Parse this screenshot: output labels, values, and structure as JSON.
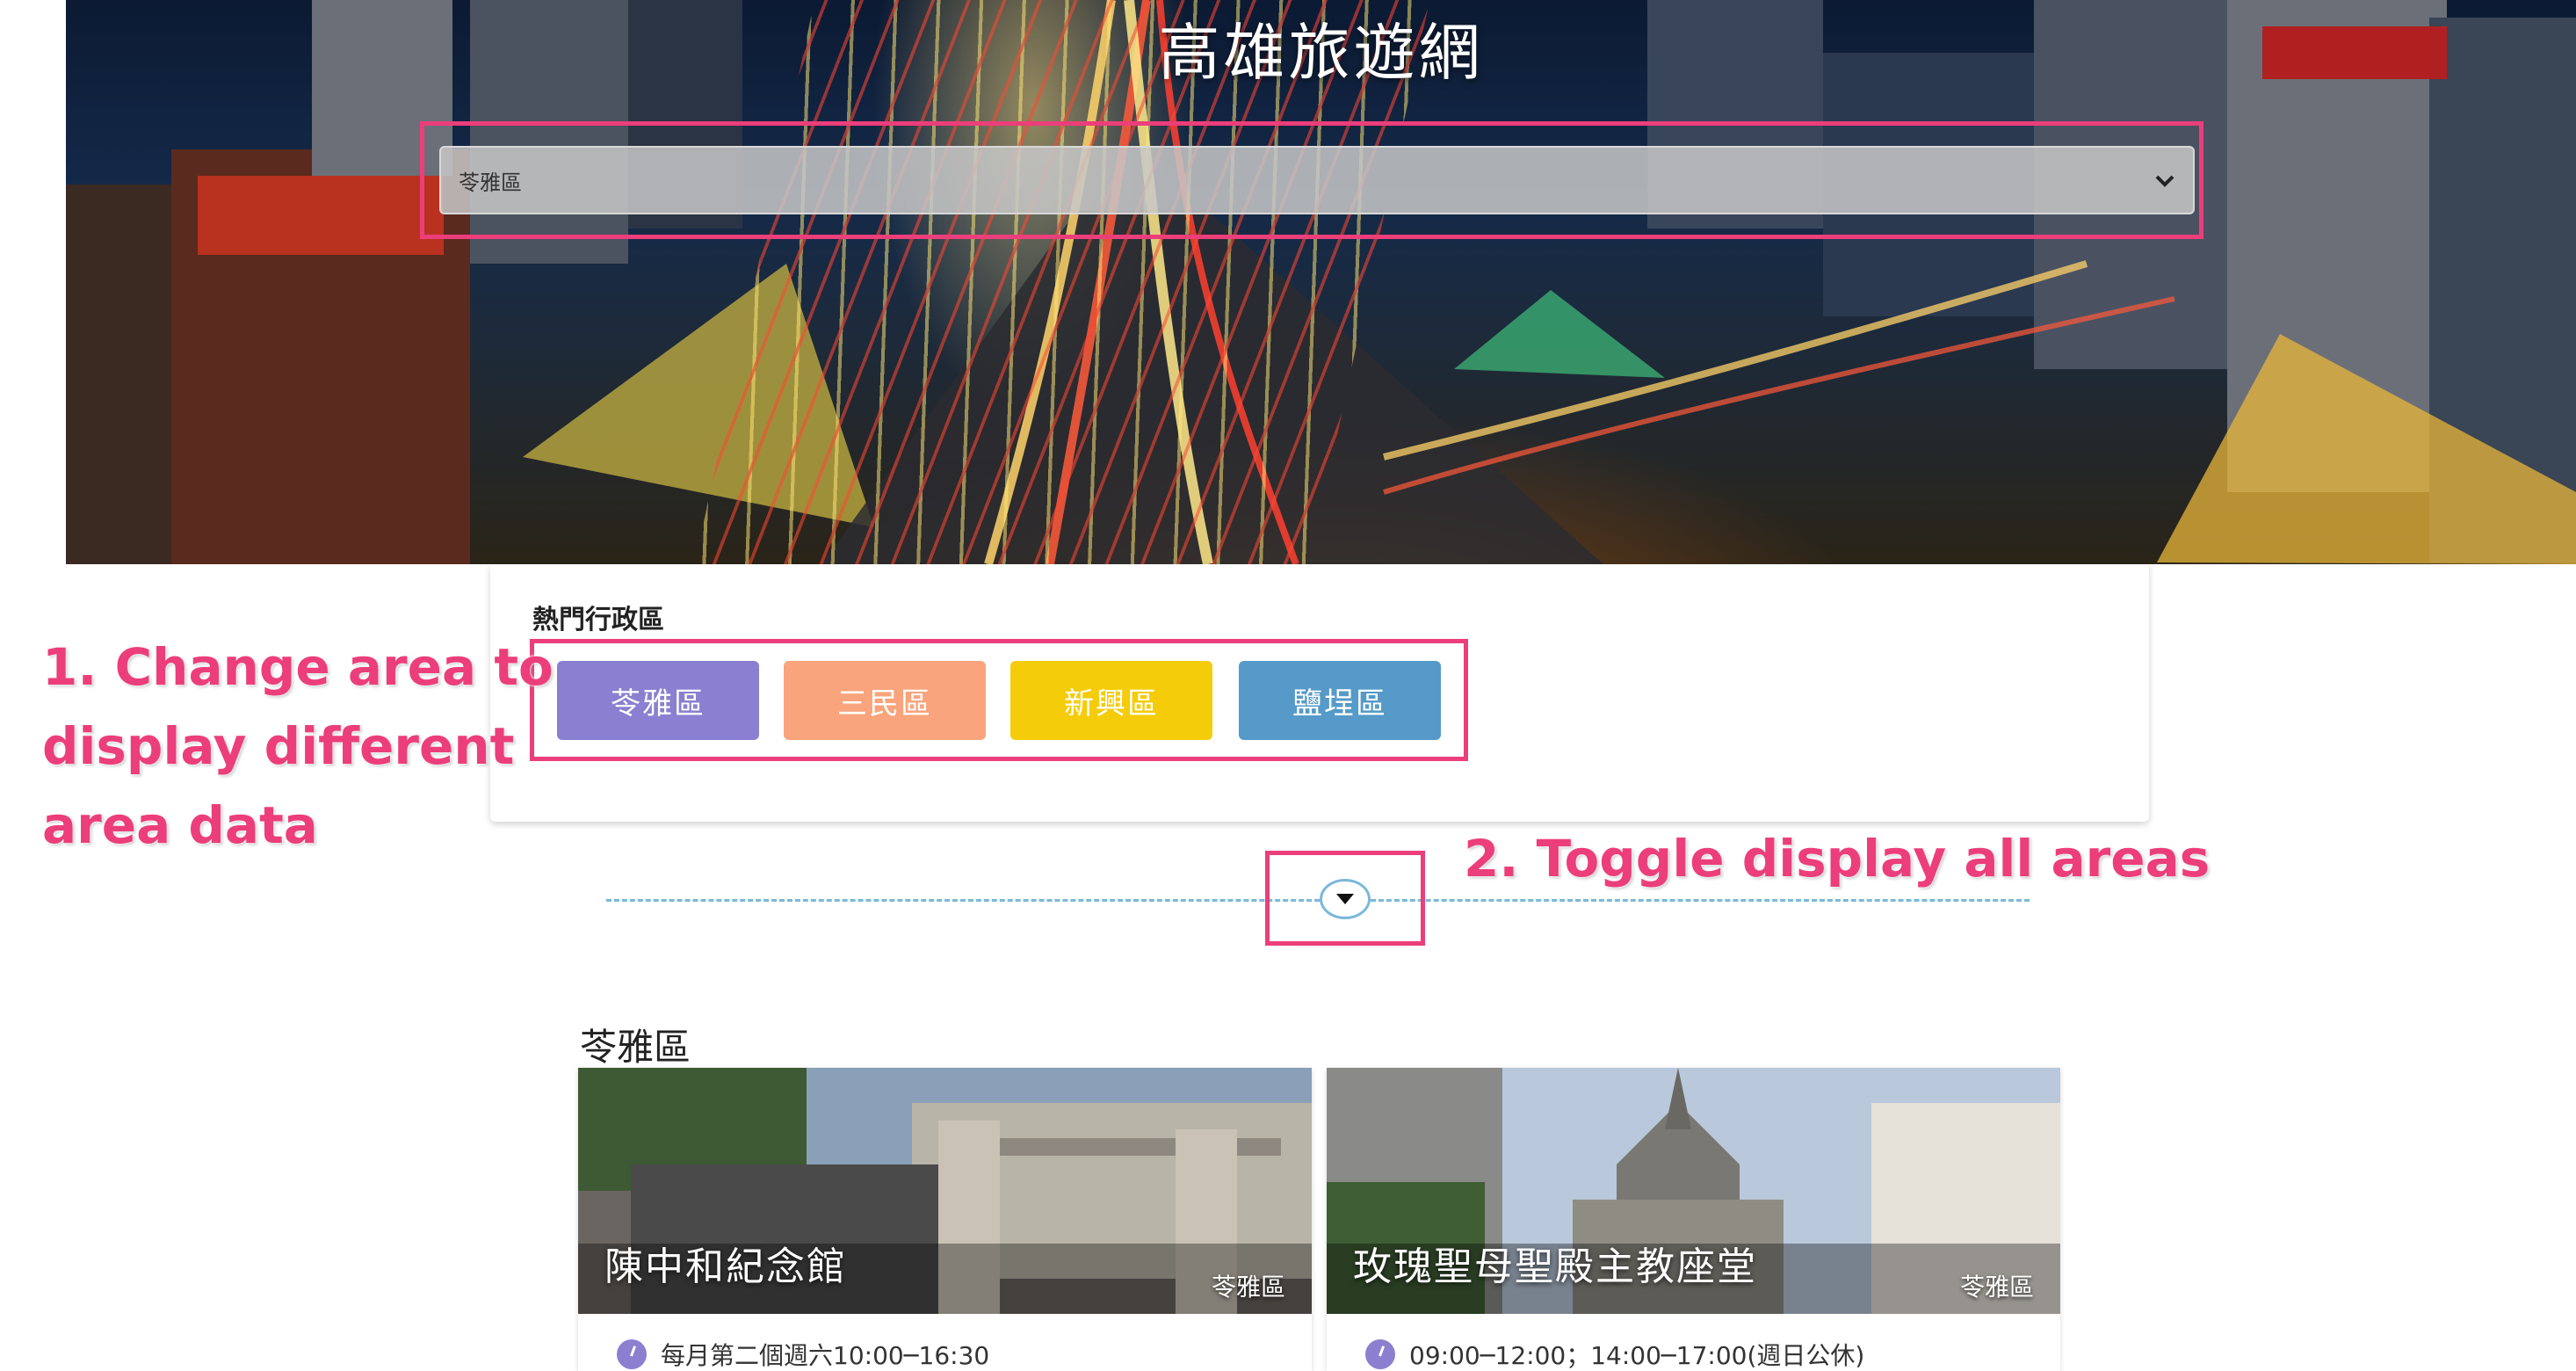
{
  "site": {
    "title": "高雄旅遊網"
  },
  "district_select": {
    "selected": "苓雅區"
  },
  "popular": {
    "label": "熱門行政區",
    "buttons": [
      {
        "label": "苓雅區",
        "color": "#8a7fd0"
      },
      {
        "label": "三民區",
        "color": "#f9a47c"
      },
      {
        "label": "新興區",
        "color": "#f5cc0a"
      },
      {
        "label": "鹽埕區",
        "color": "#559ac8"
      }
    ]
  },
  "annotations": {
    "change_area": [
      "1. Change area to",
      "display different",
      "area data"
    ],
    "toggle": "2. Toggle display all areas"
  },
  "colors": {
    "annotation": "#ec3e7a",
    "dashed_line": "#7ab8da"
  },
  "section": {
    "title": "苓雅區",
    "spots": [
      {
        "name": "陳中和紀念館",
        "zone": "苓雅區",
        "hours": "每月第二個週六10:00─16:30"
      },
      {
        "name": "玫瑰聖母聖殿主教座堂",
        "zone": "苓雅區",
        "hours": "09:00─12:00；14:00─17:00(週日公休)"
      }
    ]
  }
}
